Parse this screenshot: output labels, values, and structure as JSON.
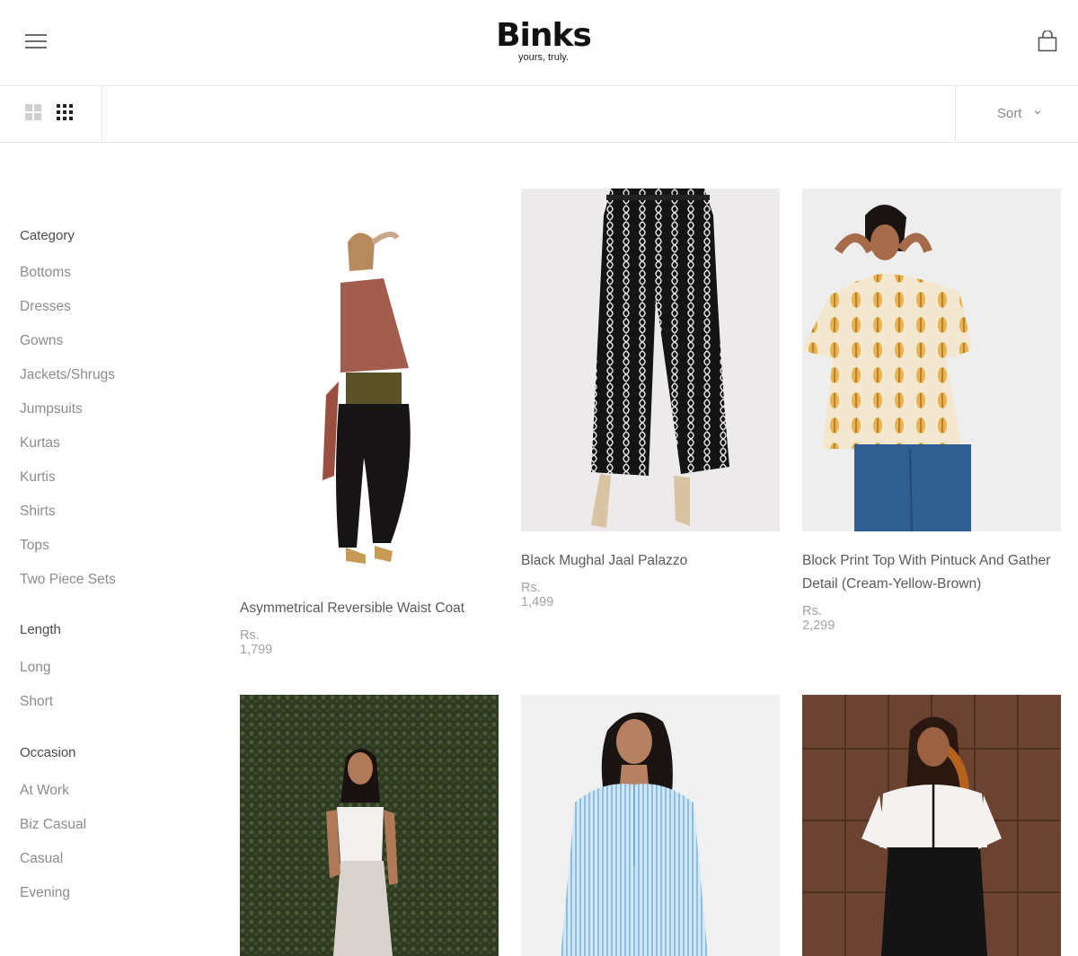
{
  "header": {
    "brand": "Binks",
    "tagline": "yours, truly."
  },
  "toolbar": {
    "sort_label": "Sort"
  },
  "filters": [
    {
      "title": "Category",
      "items": [
        "Bottoms",
        "Dresses",
        "Gowns",
        "Jackets/Shrugs",
        "Jumpsuits",
        "Kurtas",
        "Kurtis",
        "Shirts",
        "Tops",
        "Two Piece Sets"
      ]
    },
    {
      "title": "Length",
      "items": [
        "Long",
        "Short"
      ]
    },
    {
      "title": "Occasion",
      "items": [
        "At Work",
        "Biz Casual",
        "Casual",
        "Evening"
      ]
    }
  ],
  "products": [
    {
      "name": "Asymmetrical Reversible Waist Coat",
      "price": "Rs. 1,799"
    },
    {
      "name": "Black Mughal Jaal Palazzo",
      "price": "Rs. 1,499"
    },
    {
      "name": "Block Print Top With Pintuck And Gather Detail (Cream-Yellow-Brown)",
      "price": "Rs. 2,299"
    },
    {
      "name": "",
      "price": ""
    },
    {
      "name": "",
      "price": ""
    },
    {
      "name": "",
      "price": ""
    }
  ],
  "colors": {
    "border": "#e6e6e6",
    "text_muted": "#8c8c8c",
    "brand": "#111111"
  },
  "icons": [
    "hamburger-icon",
    "cart-icon",
    "grid-2-view-icon",
    "grid-3-view-icon",
    "chevron-down-icon"
  ]
}
